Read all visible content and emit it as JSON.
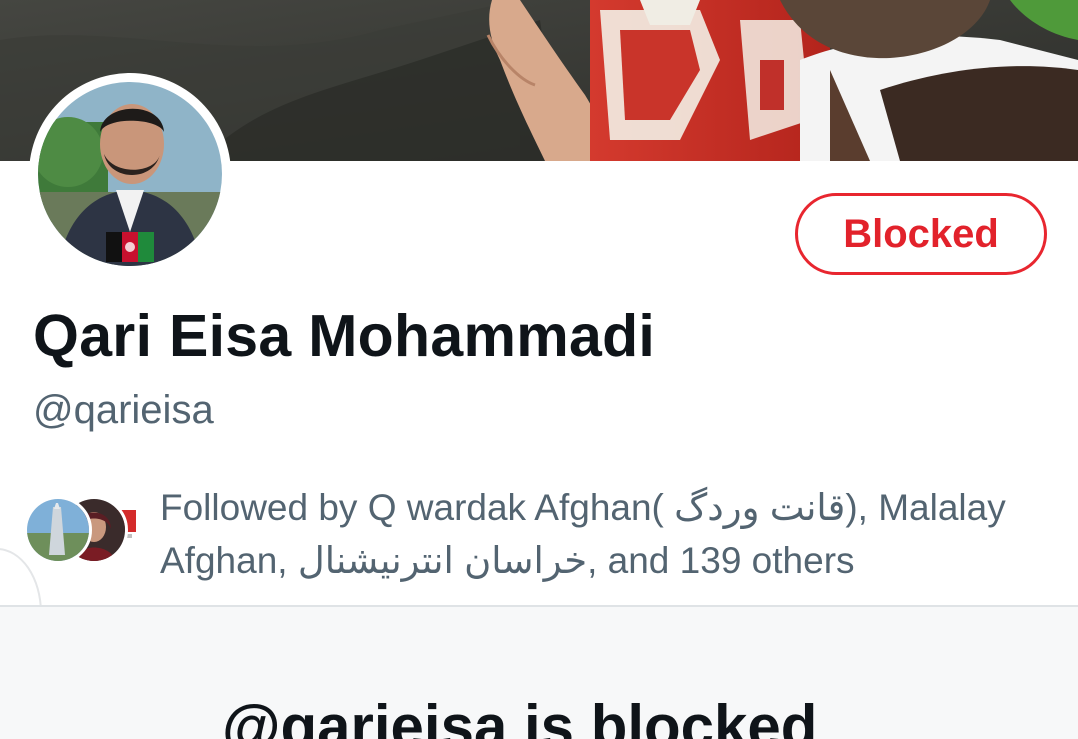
{
  "profile": {
    "display_name": "Qari Eisa Mohammadi",
    "handle": "@qarieisa",
    "blocked_button_label": "Blocked",
    "followed_by_text": "Followed by Q wardak Afghan( قانت وردگ), Malalay Afghan, خراسان انترنيشنال, and 139 others"
  },
  "blocked_notice": {
    "heading": "@qarieisa is blocked"
  },
  "colors": {
    "blocked_red": "#e2222b",
    "text_primary": "#0f1419",
    "text_secondary": "#536471"
  },
  "icons": {
    "side_handle": "chevron-right-icon"
  }
}
